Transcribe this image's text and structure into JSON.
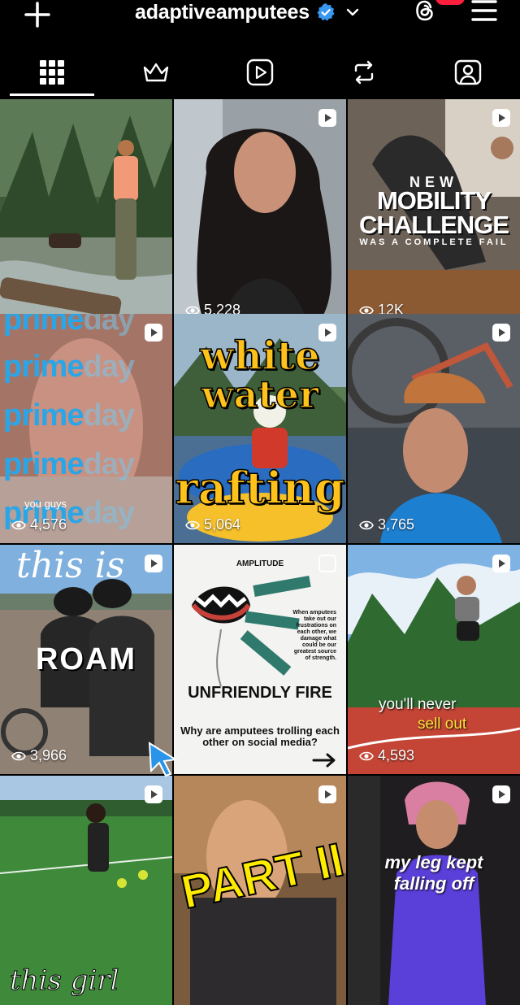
{
  "header": {
    "username": "adaptiveamputees",
    "icons": {
      "create": "plus-icon",
      "verified": "verified-badge-icon",
      "switch": "chevron-down-icon",
      "threads": "threads-icon",
      "menu": "hamburger-menu-icon"
    },
    "colors": {
      "verified": "#3897f0",
      "notification": "#ff1f3d"
    }
  },
  "tabs": [
    {
      "name": "posts",
      "icon": "grid-icon",
      "active": true
    },
    {
      "name": "subscriptions",
      "icon": "crown-icon",
      "active": false
    },
    {
      "name": "reels",
      "icon": "reels-icon",
      "active": false
    },
    {
      "name": "reposts",
      "icon": "repost-icon",
      "active": false
    },
    {
      "name": "tagged",
      "icon": "tagged-icon",
      "active": false
    }
  ],
  "posts": [
    {
      "views": "",
      "caption": []
    },
    {
      "views": "5,228",
      "caption": []
    },
    {
      "views": "12K",
      "caption": [
        "NEW",
        "MOBILITY",
        "CHALLENGE",
        "WAS A COMPLETE FAIL"
      ]
    },
    {
      "views": "4,576",
      "caption": [
        "prime",
        "day",
        "you guys"
      ]
    },
    {
      "views": "5,064",
      "caption": [
        "white",
        "water",
        "rafting"
      ]
    },
    {
      "views": "3,765",
      "caption": []
    },
    {
      "views": "3,966",
      "caption": [
        "this is",
        "ROAM"
      ]
    },
    {
      "views": "",
      "caption": [
        "AMPLITUDE",
        "When amputees take out our frustrations on each other, we damage what could be our greatest source of strength.",
        "UNFRIENDLY FIRE",
        "Why are amputees trolling each other on social media?"
      ]
    },
    {
      "views": "4,593",
      "caption": [
        "you'll never",
        "sell out"
      ]
    },
    {
      "views": "",
      "caption": [
        "this girl"
      ]
    },
    {
      "views": "",
      "caption": [
        "PART II"
      ]
    },
    {
      "views": "",
      "caption": [
        "my leg kept",
        "falling off"
      ]
    }
  ]
}
